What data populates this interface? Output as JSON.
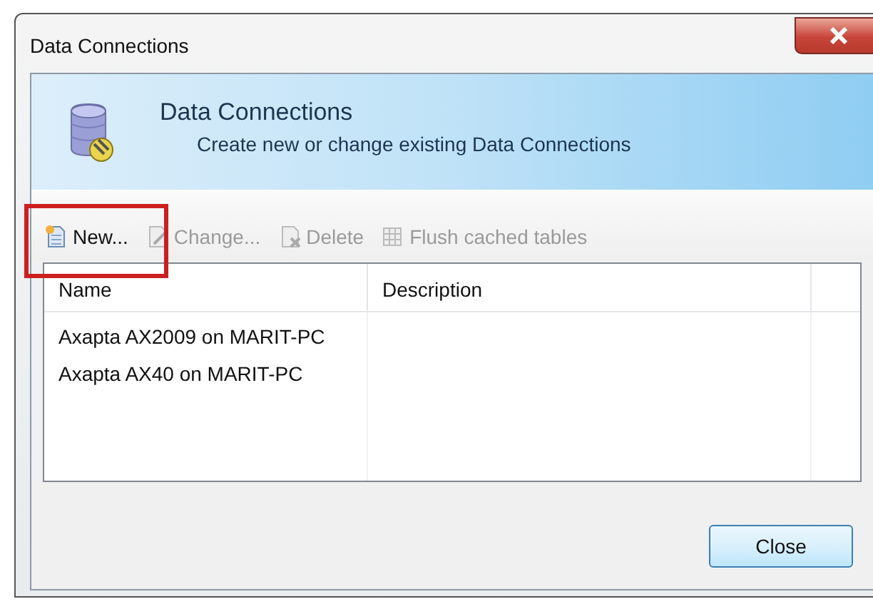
{
  "window": {
    "title": "Data Connections"
  },
  "header": {
    "title": "Data Connections",
    "subtitle": "Create new or change existing Data Connections"
  },
  "toolbar": [
    {
      "kind": "new",
      "label": "New...",
      "disabled": false
    },
    {
      "kind": "change",
      "label": "Change...",
      "disabled": true
    },
    {
      "kind": "delete",
      "label": "Delete",
      "disabled": true
    },
    {
      "kind": "flush",
      "label": "Flush cached tables",
      "disabled": true
    }
  ],
  "table": {
    "columns": [
      "Name",
      "Description"
    ],
    "rows": [
      {
        "name": "Axapta AX2009 on MARIT-PC"
      },
      {
        "name": "Axapta AX40 on MARIT-PC"
      }
    ]
  },
  "buttons": [
    "Close"
  ]
}
